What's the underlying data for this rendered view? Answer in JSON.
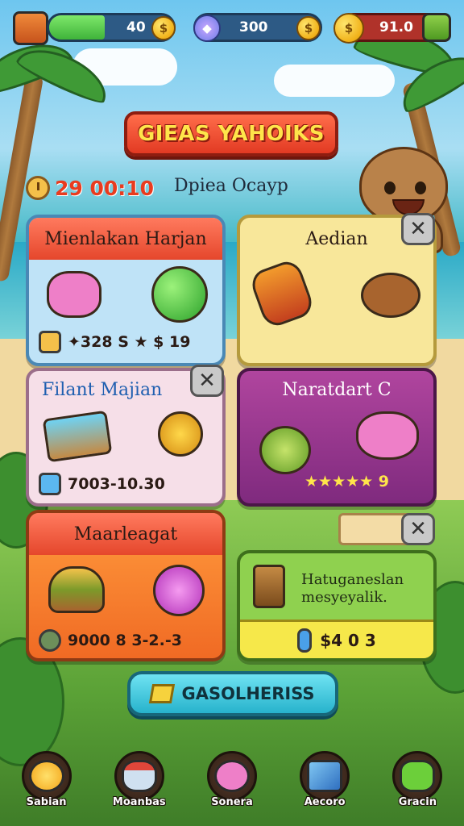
{
  "hud": {
    "energy_value": "40",
    "energy_fill": 0.45,
    "gems_value": "300",
    "coins_value": "91.0"
  },
  "title": "GIEAS YAHOIKS",
  "timer": "29 00:10",
  "subtitle": "Dpiea Ocayp",
  "cards": [
    {
      "title": "Mienlakan Harjan",
      "reward": "✦328 S ★ $ 19",
      "color": "#f36a52"
    },
    {
      "title": "Aedian",
      "reward": "",
      "color": "#f8e79a"
    },
    {
      "title": "Filant Majian",
      "reward": "7003-10.30",
      "color": "#f6dfe8"
    },
    {
      "title": "Naratdart C",
      "reward": "★★★★★ 9",
      "color": "#9b3d95"
    },
    {
      "title": "Maarleagat",
      "reward": "9000 8 3-2.-3",
      "color": "#f26c3a"
    },
    {
      "title": "Hatuganeslan mesyeyalik.",
      "reward": "$4 0 3",
      "color": "#8fd14f"
    }
  ],
  "cta_label": "GASOLHERISS",
  "nav": [
    {
      "label": "Sabian",
      "icon": "sun-icon"
    },
    {
      "label": "Moanbas",
      "icon": "bear-icon"
    },
    {
      "label": "Sonera",
      "icon": "pig-icon"
    },
    {
      "label": "Aecoro",
      "icon": "book-icon"
    },
    {
      "label": "Gracin",
      "icon": "frog-icon"
    }
  ]
}
